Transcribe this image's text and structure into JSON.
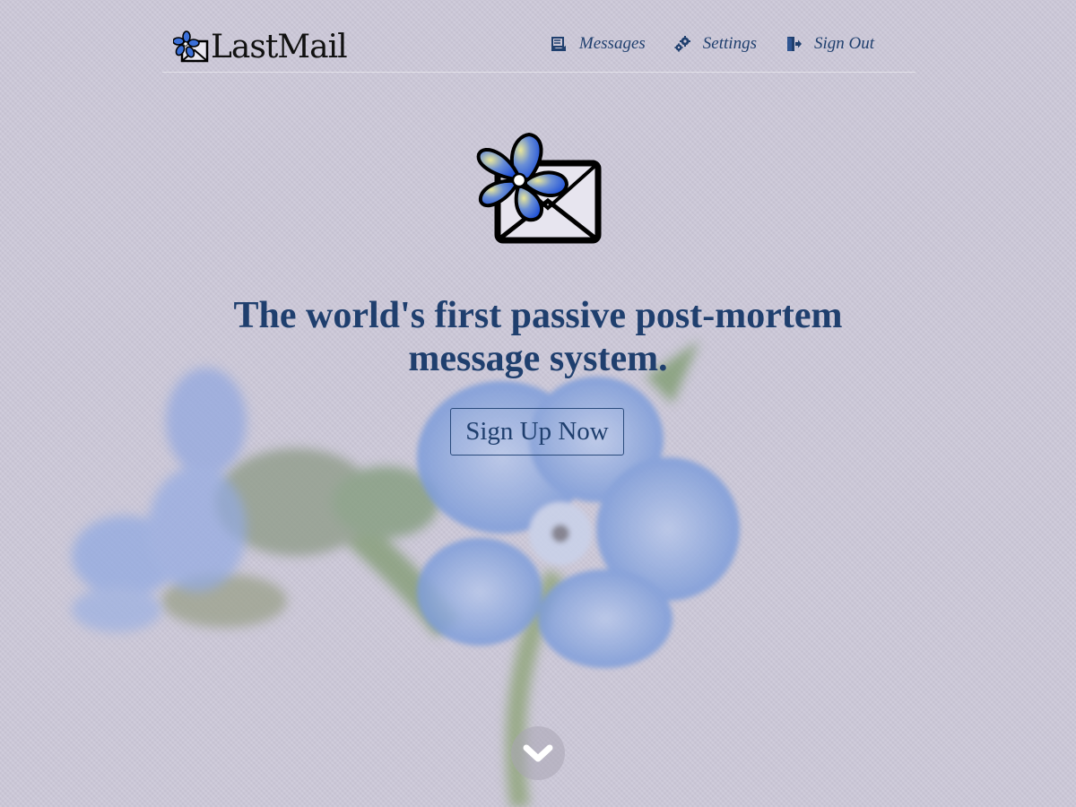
{
  "brand": {
    "name": "LastMail",
    "logo_icon": "flower-envelope-icon"
  },
  "nav": {
    "items": [
      {
        "label": "Messages",
        "icon": "messages-icon"
      },
      {
        "label": "Settings",
        "icon": "gears-icon"
      },
      {
        "label": "Sign Out",
        "icon": "sign-out-icon"
      }
    ]
  },
  "hero": {
    "logo_icon": "flower-envelope-icon",
    "headline_line1": "The world's first passive post-mortem",
    "headline_line2": "message system.",
    "cta_label": "Sign Up Now"
  },
  "scroll": {
    "icon": "chevron-down-icon"
  },
  "colors": {
    "background": "#ccc8d8",
    "text_primary": "#1f3f6e",
    "flower_blue": "#3a6fd8",
    "brand_text": "#111111"
  }
}
